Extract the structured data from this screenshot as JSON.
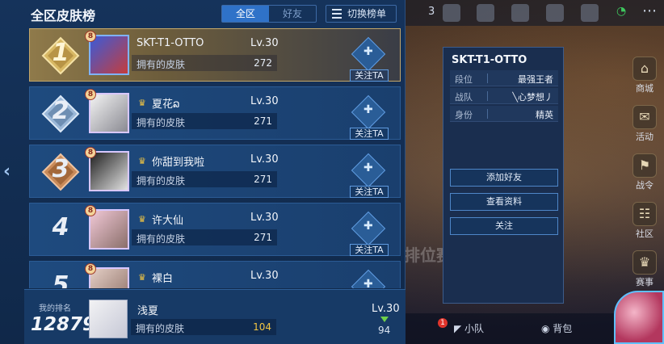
{
  "header": {
    "title": "全区皮肤榜",
    "tabs": [
      {
        "label": "全区",
        "active": true
      },
      {
        "label": "好友",
        "active": false
      }
    ],
    "switch_label": "切换榜单"
  },
  "rows": [
    {
      "rank": "1",
      "name": "SKT-T1-OTTO",
      "level": "Lv.30",
      "skins_label": "拥有的皮肤",
      "skins": "272",
      "follow": "关注TA",
      "vip": "8",
      "crown": false
    },
    {
      "rank": "2",
      "name": "夏花ລ",
      "level": "Lv.30",
      "skins_label": "拥有的皮肤",
      "skins": "271",
      "follow": "关注TA",
      "vip": "8",
      "crown": true
    },
    {
      "rank": "3",
      "name": "你甜到我啦",
      "level": "Lv.30",
      "skins_label": "拥有的皮肤",
      "skins": "271",
      "follow": "关注TA",
      "vip": "8",
      "crown": true
    },
    {
      "rank": "4",
      "name": "许大仙",
      "level": "Lv.30",
      "skins_label": "拥有的皮肤",
      "skins": "271",
      "follow": "关注TA",
      "vip": "8",
      "crown": true
    },
    {
      "rank": "5",
      "name": "裸白",
      "level": "Lv.30",
      "skins_label": "",
      "skins": "",
      "follow": "",
      "vip": "8",
      "crown": true
    }
  ],
  "my": {
    "label": "我的排名",
    "rank": "12879",
    "name": "浅夏",
    "skins_label": "拥有的皮肤",
    "skins": "104",
    "level": "Lv.30",
    "change": "94"
  },
  "popup": {
    "title": "SKT-T1-OTTO",
    "fields": [
      {
        "key": "段位",
        "value": "最强王者"
      },
      {
        "key": "战队",
        "value": "╲心梦想丿"
      },
      {
        "key": "身份",
        "value": "精英"
      }
    ],
    "buttons": [
      "添加好友",
      "查看资料",
      "关注"
    ]
  },
  "topbar": {
    "count": "3"
  },
  "side_items": [
    "商城",
    "活动",
    "战令",
    "社区",
    "赛事"
  ],
  "bottom": {
    "team": "小队",
    "bag": "背包",
    "badge": "1",
    "faded": "排位赛"
  },
  "colors": {
    "gold_row": "#8f7a4a",
    "row": "#1e4a7e",
    "accent": "#2f72c8",
    "skins_mine": "#f0c443"
  }
}
